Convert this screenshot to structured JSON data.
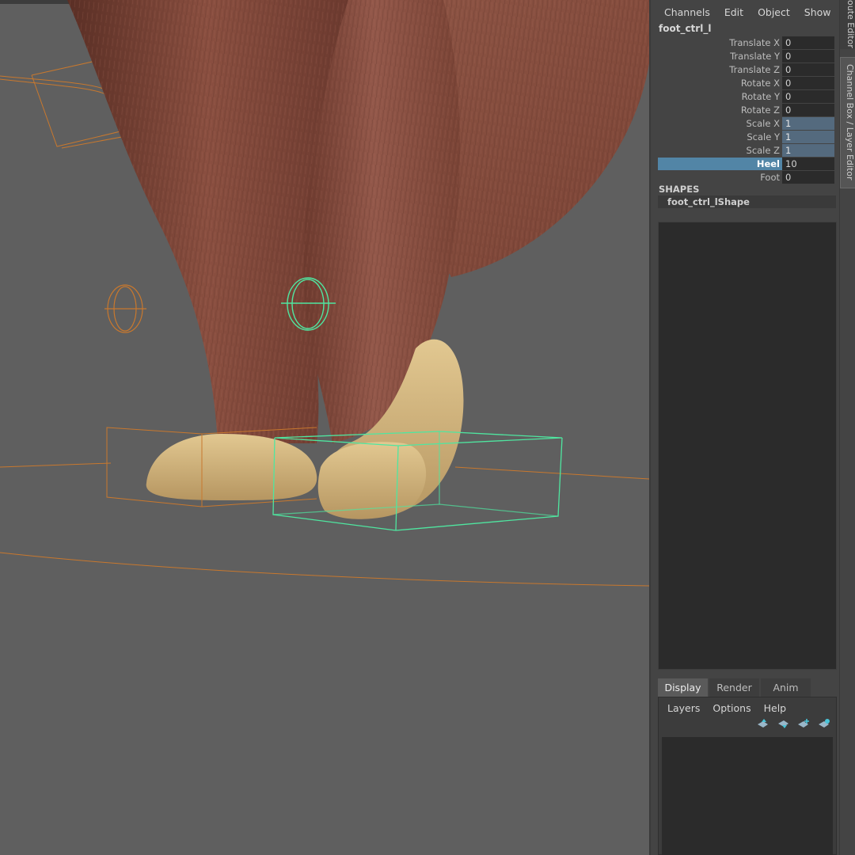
{
  "viewport": {
    "background": "#5f5f5f"
  },
  "channel_box": {
    "menu": [
      "Channels",
      "Edit",
      "Object",
      "Show"
    ],
    "node_name": "foot_ctrl_l",
    "attributes": [
      {
        "label": "Translate X",
        "value": "0"
      },
      {
        "label": "Translate Y",
        "value": "0"
      },
      {
        "label": "Translate Z",
        "value": "0"
      },
      {
        "label": "Rotate X",
        "value": "0"
      },
      {
        "label": "Rotate Y",
        "value": "0"
      },
      {
        "label": "Rotate Z",
        "value": "0"
      },
      {
        "label": "Scale X",
        "value": "1"
      },
      {
        "label": "Scale Y",
        "value": "1"
      },
      {
        "label": "Scale Z",
        "value": "1"
      },
      {
        "label": "Heel",
        "value": "10"
      },
      {
        "label": "Foot",
        "value": "0"
      }
    ],
    "shapes_title": "SHAPES",
    "shape_name": "foot_ctrl_lShape"
  },
  "layer_editor": {
    "tabs": [
      "Display",
      "Render",
      "Anim"
    ],
    "active_tab": "Display",
    "menu": [
      "Layers",
      "Options",
      "Help"
    ]
  },
  "side_tabs": {
    "attribute_editor": "oute Editor",
    "channel_box": "Channel Box / Layer Editor"
  },
  "colors": {
    "selection": "#5285a6",
    "scale_field": "#546a7e",
    "rig_orange": "#c8782e",
    "rig_green": "#4fe6a0",
    "fur_brown": "#8a4e3f",
    "fur_tan": "#d8bb84"
  },
  "icons": [
    "layer-move-up-icon",
    "layer-move-down-icon",
    "new-layer-icon",
    "new-layer-selected-icon"
  ]
}
